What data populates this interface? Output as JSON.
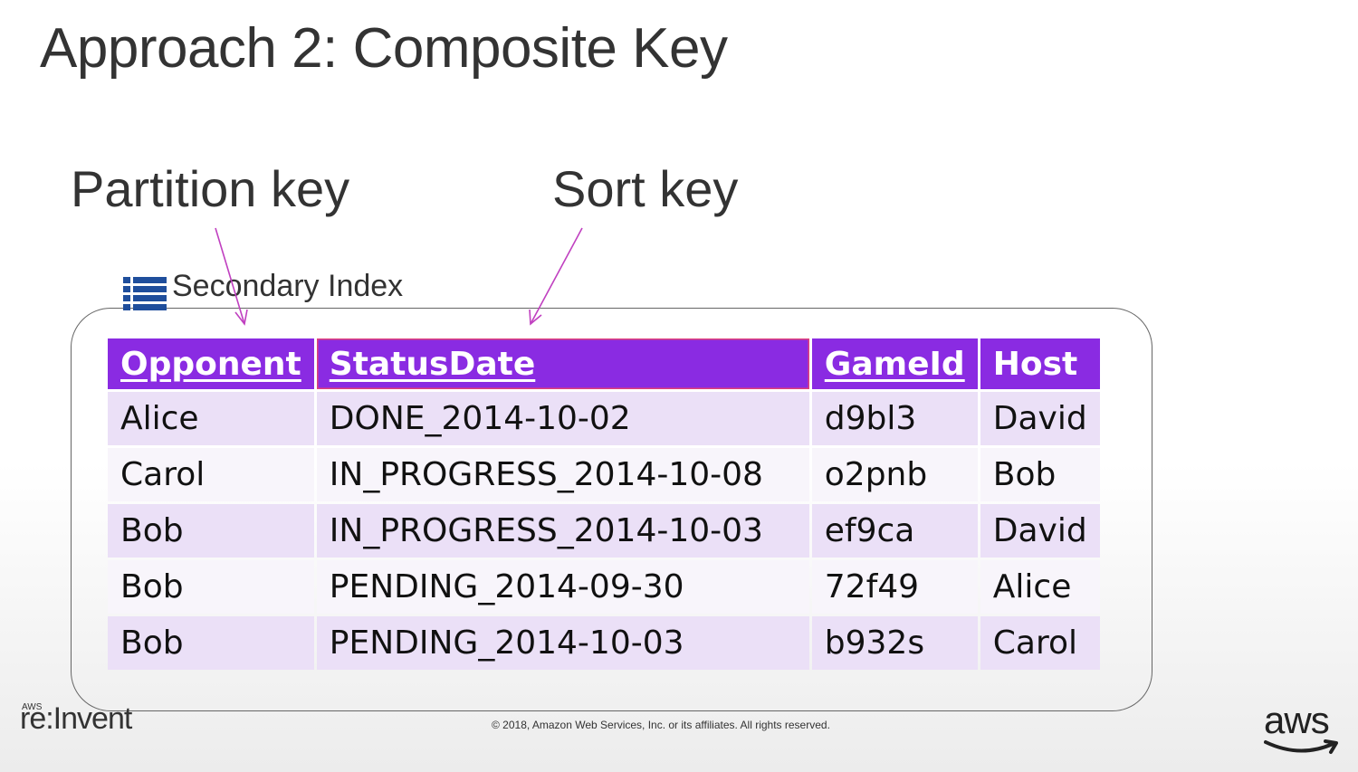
{
  "slide": {
    "title": "Approach 2: Composite Key"
  },
  "callouts": {
    "partition_key": "Partition key",
    "sort_key": "Sort key"
  },
  "index": {
    "label": "Secondary Index",
    "icon": "table-list-icon",
    "columns": [
      "Opponent",
      "StatusDate",
      "GameId",
      "Host"
    ],
    "rows": [
      [
        "Alice",
        "DONE_2014-10-02",
        "d9bl3",
        "David"
      ],
      [
        "Carol",
        "IN_PROGRESS_2014-10-08",
        "o2pnb",
        "Bob"
      ],
      [
        "Bob",
        "IN_PROGRESS_2014-10-03",
        "ef9ca",
        "David"
      ],
      [
        "Bob",
        "PENDING_2014-09-30",
        "72f49",
        "Alice"
      ],
      [
        "Bob",
        "PENDING_2014-10-03",
        "b932s",
        "Carol"
      ]
    ]
  },
  "footer": {
    "event_logo_small": "AWS",
    "event_logo": "re:Invent",
    "copyright": "© 2018, Amazon Web Services, Inc. or its affiliates. All rights reserved.",
    "brand_logo": "aws"
  },
  "colors": {
    "header_purple": "#8a2be2",
    "row_odd": "#ebe0f7",
    "row_even": "#f8f5fb",
    "arrow": "#c040c0",
    "icon_blue": "#1f4e9c"
  }
}
